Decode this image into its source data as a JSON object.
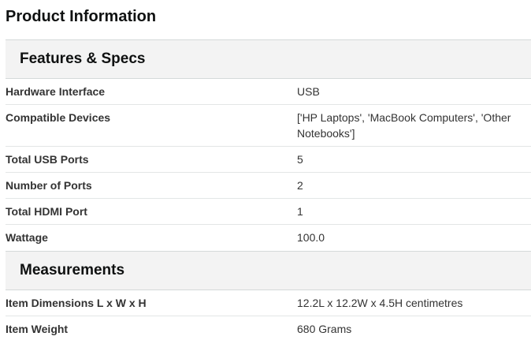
{
  "title": "Product Information",
  "sections": [
    {
      "heading": "Features & Specs",
      "rows": [
        {
          "label": "Hardware Interface",
          "value": "USB"
        },
        {
          "label": "Compatible Devices",
          "value": "['HP Laptops', 'MacBook Computers', 'Other Notebooks']"
        },
        {
          "label": "Total USB Ports",
          "value": "5"
        },
        {
          "label": "Number of Ports",
          "value": "2"
        },
        {
          "label": "Total HDMI Port",
          "value": "1"
        },
        {
          "label": "Wattage",
          "value": "100.0"
        }
      ]
    },
    {
      "heading": "Measurements",
      "rows": [
        {
          "label": "Item Dimensions L x W x H",
          "value": "12.2L x 12.2W x 4.5H centimetres"
        },
        {
          "label": "Item Weight",
          "value": "680 Grams"
        }
      ]
    }
  ]
}
